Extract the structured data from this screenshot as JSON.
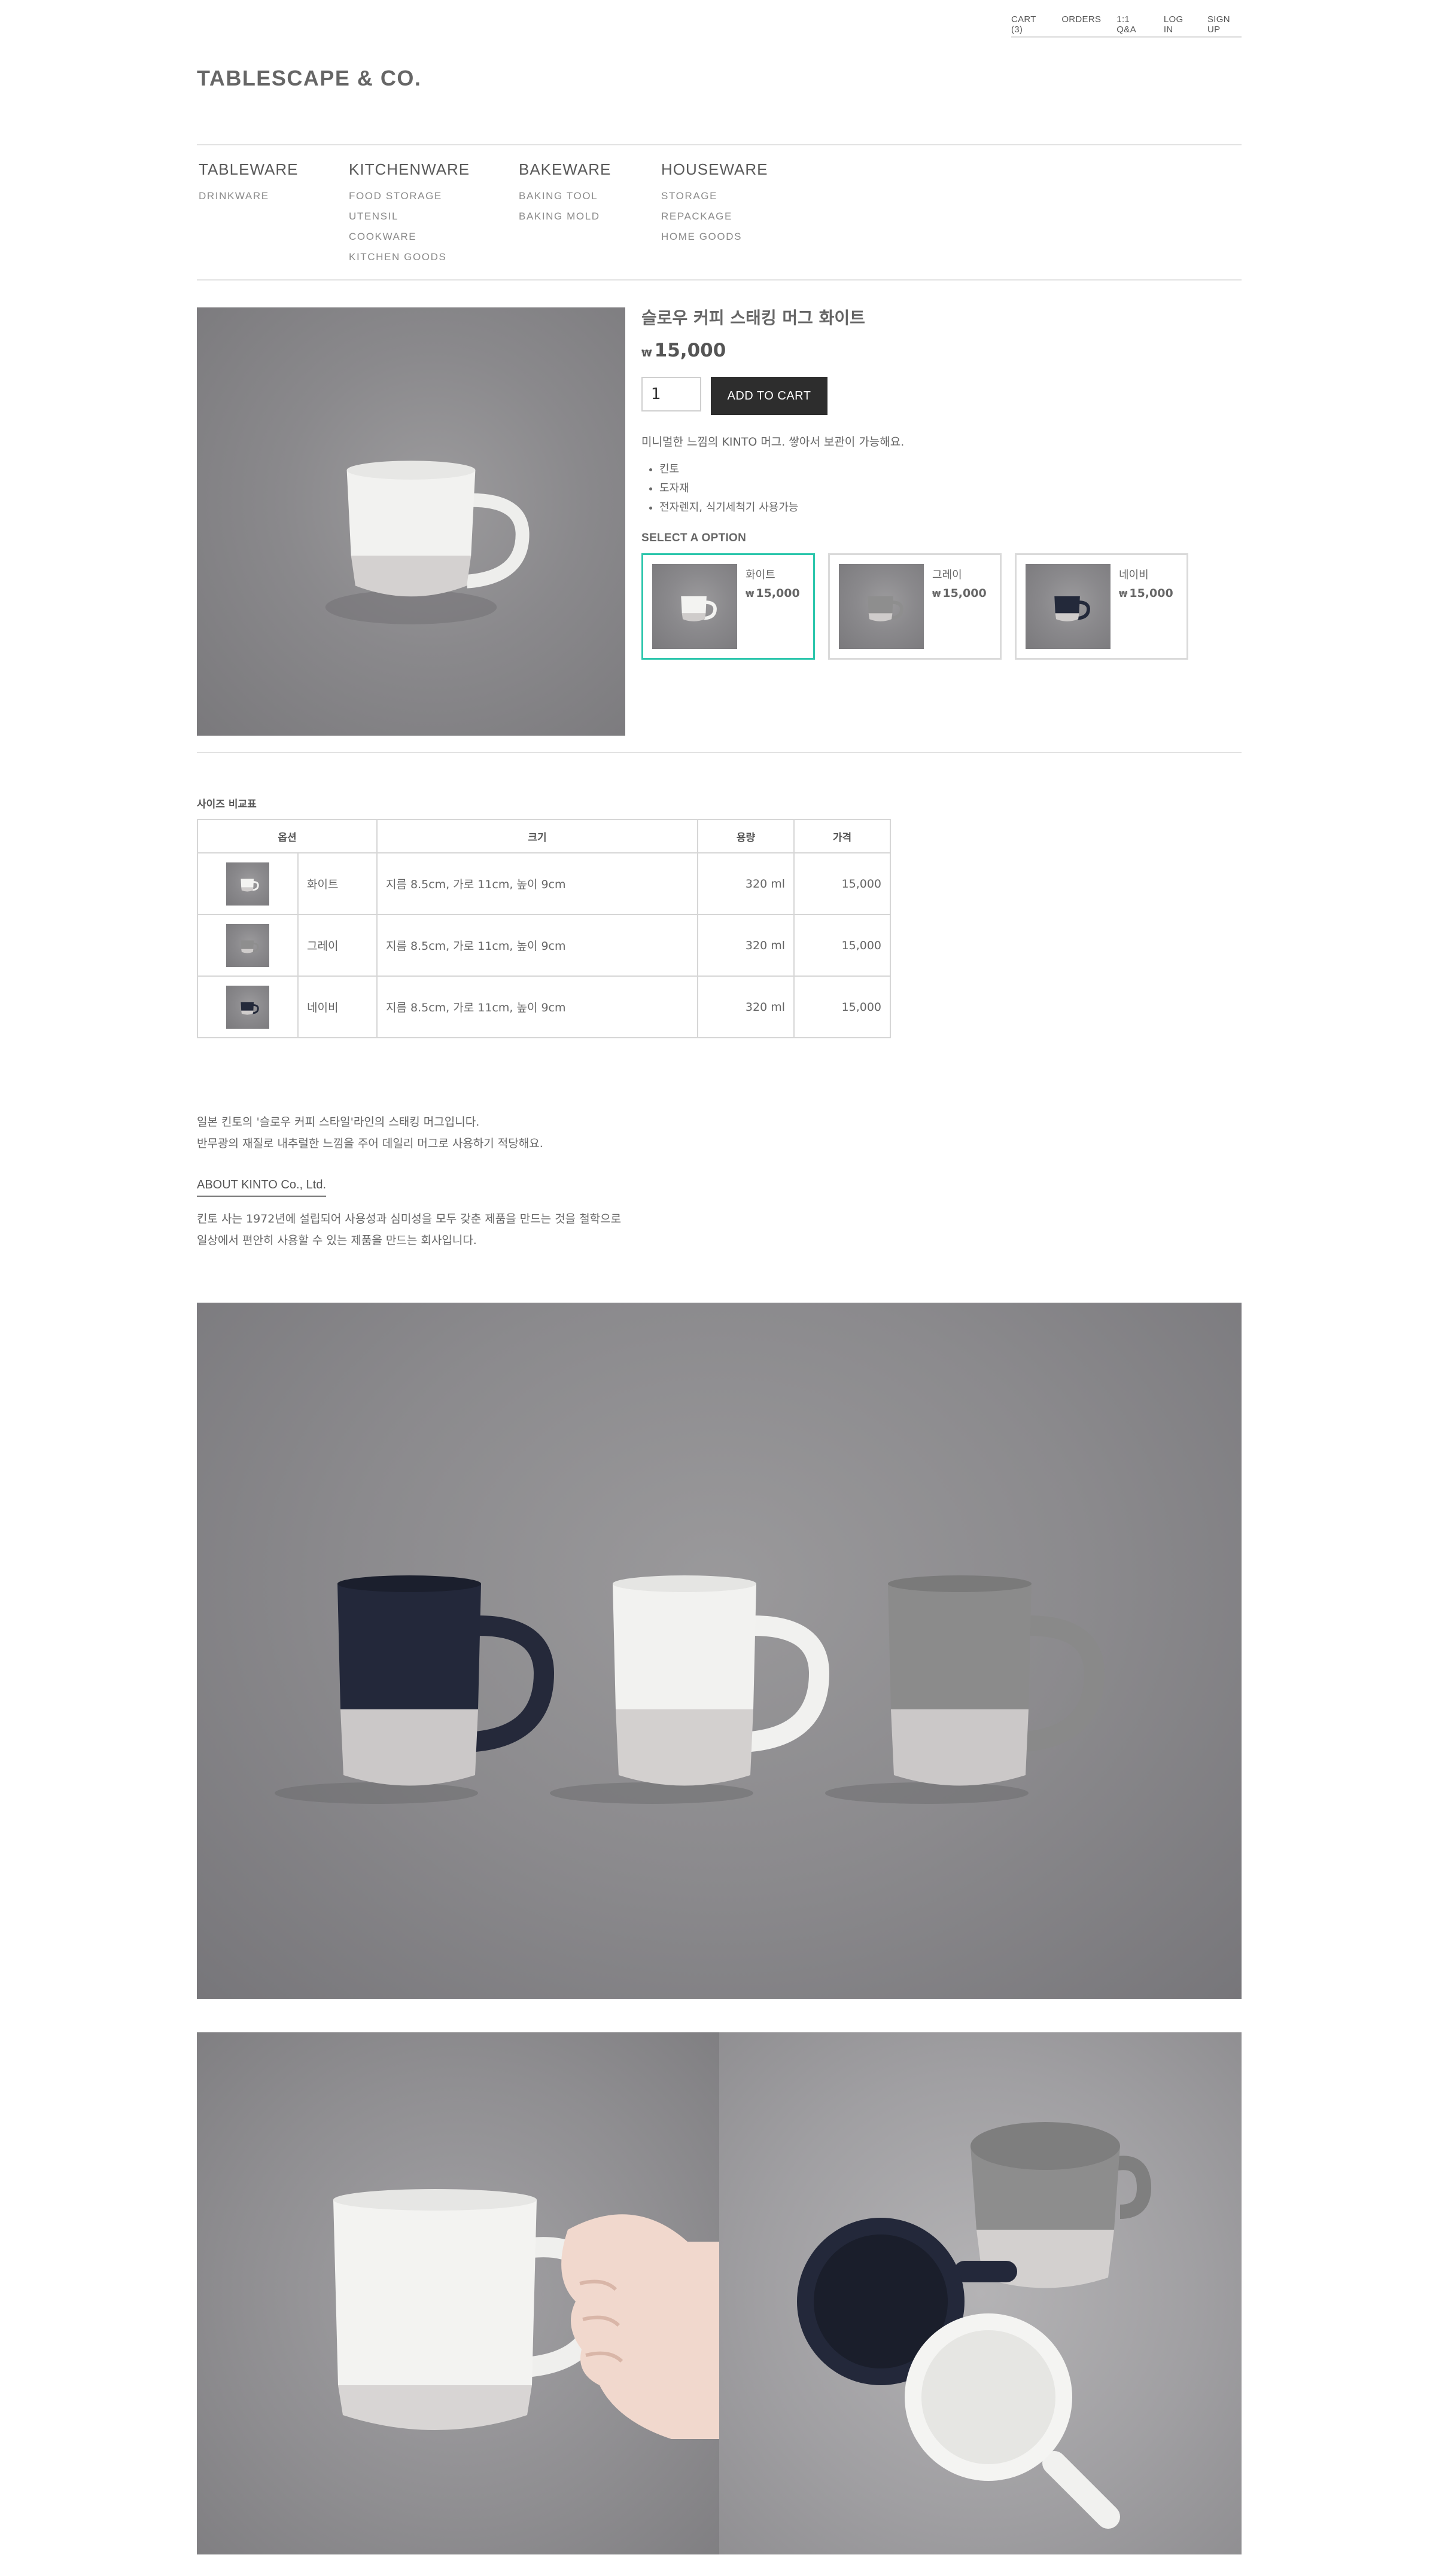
{
  "utility_nav": [
    "CART (3)",
    "ORDERS",
    "1:1 Q&A",
    "LOG IN",
    "SIGN UP"
  ],
  "logo": "TABLESCAPE & CO.",
  "categories": [
    {
      "label": "TABLEWARE",
      "items": [
        "DRINKWARE"
      ]
    },
    {
      "label": "KITCHENWARE",
      "items": [
        "FOOD STORAGE",
        "UTENSIL",
        "COOKWARE",
        "KITCHEN GOODS"
      ]
    },
    {
      "label": "BAKEWARE",
      "items": [
        "BAKING TOOL",
        "BAKING MOLD"
      ]
    },
    {
      "label": "HOUSEWARE",
      "items": [
        "STORAGE",
        "REPACKAGE",
        "HOME GOODS"
      ]
    }
  ],
  "product": {
    "title": "슬로우 커피 스태킹 머그 화이트",
    "currency": "₩",
    "price": "15,000",
    "quantity": "1",
    "add_to_cart": "ADD TO CART",
    "description": "미니멀한 느낌의 KINTO 머그. 쌓아서 보관이 가능해요.",
    "bullets": [
      "킨토",
      "도자재",
      "전자렌지, 식기세척기 사용가능"
    ],
    "select_option_label": "SELECT A OPTION",
    "options": [
      {
        "name": "화이트",
        "price": "15,000",
        "selected": true,
        "mug_color": "#f3f3f1"
      },
      {
        "name": "그레이",
        "price": "15,000",
        "selected": false,
        "mug_color": "#8e8e8e"
      },
      {
        "name": "네이비",
        "price": "15,000",
        "selected": false,
        "mug_color": "#23293a"
      }
    ]
  },
  "size_table": {
    "title": "사이즈 비교표",
    "headers": [
      "옵션",
      "크기",
      "용량",
      "가격"
    ],
    "rows": [
      {
        "name": "화이트",
        "size": "지름 8.5cm, 가로 11cm, 높이 9cm",
        "capacity": "320 ml",
        "price": "15,000"
      },
      {
        "name": "그레이",
        "size": "지름 8.5cm, 가로 11cm, 높이 9cm",
        "capacity": "320 ml",
        "price": "15,000"
      },
      {
        "name": "네이비",
        "size": "지름 8.5cm, 가로 11cm, 높이 9cm",
        "capacity": "320 ml",
        "price": "15,000"
      }
    ]
  },
  "story": {
    "lines": [
      "일본 킨토의 '슬로우 커피 스타일'라인의 스태킹 머그입니다.",
      "반무광의 재질로 내추럴한 느낌을 주어 데일리 머그로 사용하기 적당해요."
    ],
    "about_heading": "ABOUT KINTO Co., Ltd.",
    "about_lines": [
      "킨토 사는 1972년에 설립되어 사용성과 심미성을 모두 갖춘 제품을 만드는 것을 철학으로",
      "일상에서 편안히 사용할 수 있는 제품을 만드는 회사입니다."
    ]
  },
  "colors": {
    "accent_selected": "#2cc6ac",
    "button_bg": "#2d2d2d",
    "mug_white": "#f3f3f1",
    "mug_gray": "#8e8e8e",
    "mug_navy": "#23293a",
    "mug_base": "#cfcccb"
  }
}
